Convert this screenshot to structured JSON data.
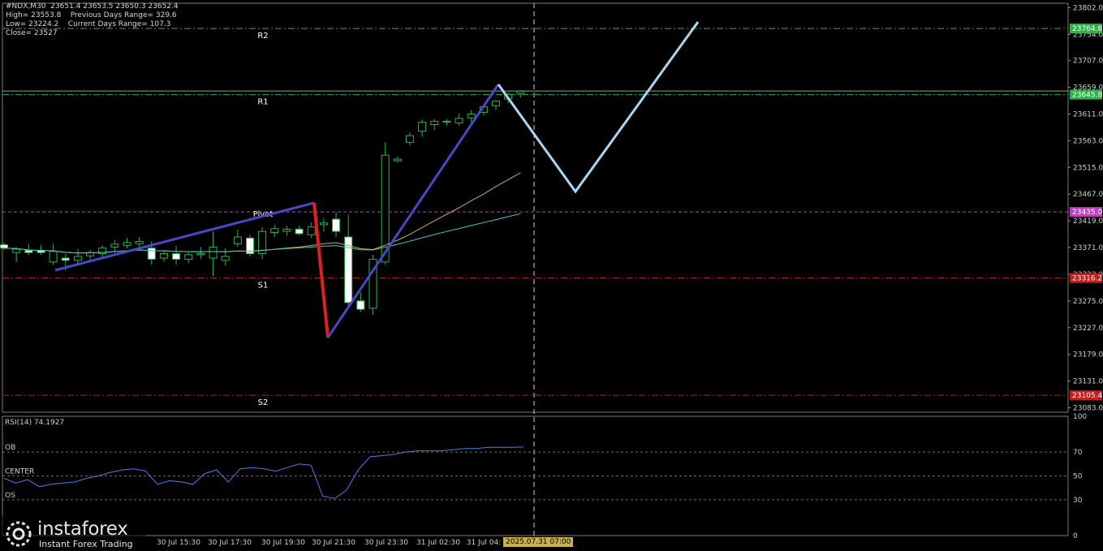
{
  "chart_data": {
    "type": "candlestick",
    "symbol_line": "#NDX,M30  23651.4 23653.5 23650.3 23652.4",
    "info_lines": [
      "High= 23553.8    Previous Days Range= 329.6",
      "Low= 23224.2    Current Days Range= 107.3",
      "Close= 23527"
    ],
    "price_axis": [
      "23802.0",
      "23754.0",
      "23707.0",
      "23659.0",
      "23611.0",
      "23563.0",
      "23515.0",
      "23467.0",
      "23419.0",
      "23371.0",
      "23323.0",
      "23275.0",
      "23227.0",
      "23179.0",
      "23131.0",
      "23083.0"
    ],
    "time_axis": [
      "30 Jul 15:30",
      "30 Jul 17:30",
      "30 Jul 19:30",
      "30 Jul 21:30",
      "30 Jul 23:30",
      "31 Jul 02:30",
      "31 Jul 04:"
    ],
    "time_tag": "2025.07.31 07:00",
    "ylim": [
      23075,
      23810
    ],
    "levels": [
      {
        "name": "R2",
        "price": 23764.6,
        "label": "23764.6",
        "color": "#2db34a",
        "style": "dashdot"
      },
      {
        "name": "R1",
        "price": 23645.8,
        "label": "23645.8",
        "color": "#2db34a",
        "style": "dashdot"
      },
      {
        "name": "Pivot",
        "price": 23435.0,
        "label": "23435.0",
        "color": "#c040c0",
        "style": "dash"
      },
      {
        "name": "S1",
        "price": 23316.2,
        "label": "23316.2",
        "color": "#c02020",
        "style": "dashdot"
      },
      {
        "name": "S2",
        "price": 23105.4,
        "label": "23105.4",
        "color": "#c02020",
        "style": "dashdot"
      }
    ],
    "level_marker_label": "23652.4",
    "candles": [
      [
        23376,
        23380,
        23366,
        23370
      ],
      [
        23362,
        23372,
        23345,
        23368
      ],
      [
        23366,
        23378,
        23357,
        23362
      ],
      [
        23366,
        23376,
        23358,
        23362
      ],
      [
        23345,
        23378,
        23340,
        23364
      ],
      [
        23352,
        23360,
        23330,
        23348
      ],
      [
        23348,
        23368,
        23340,
        23355
      ],
      [
        23356,
        23367,
        23345,
        23362
      ],
      [
        23360,
        23375,
        23352,
        23370
      ],
      [
        23372,
        23385,
        23362,
        23377
      ],
      [
        23375,
        23388,
        23370,
        23380
      ],
      [
        23378,
        23390,
        23370,
        23382
      ],
      [
        23370,
        23382,
        23340,
        23350
      ],
      [
        23352,
        23365,
        23345,
        23360
      ],
      [
        23360,
        23374,
        23340,
        23350
      ],
      [
        23350,
        23362,
        23343,
        23358
      ],
      [
        23358,
        23372,
        23350,
        23360
      ],
      [
        23352,
        23400,
        23320,
        23372
      ],
      [
        23348,
        23370,
        23338,
        23355
      ],
      [
        23378,
        23403,
        23372,
        23390
      ],
      [
        23388,
        23394,
        23355,
        23360
      ],
      [
        23360,
        23408,
        23350,
        23400
      ],
      [
        23398,
        23412,
        23390,
        23405
      ],
      [
        23400,
        23410,
        23392,
        23404
      ],
      [
        23404,
        23410,
        23393,
        23396
      ],
      [
        23394,
        23416,
        23388,
        23408
      ],
      [
        23412,
        23424,
        23400,
        23415
      ],
      [
        23422,
        23435,
        23390,
        23400
      ],
      [
        23390,
        23430,
        23262,
        23272
      ],
      [
        23275,
        23290,
        23255,
        23260
      ],
      [
        23262,
        23358,
        23250,
        23350
      ],
      [
        23345,
        23560,
        23340,
        23537
      ],
      [
        23527,
        23535,
        23524,
        23530
      ],
      [
        23560,
        23578,
        23555,
        23572
      ],
      [
        23580,
        23601,
        23570,
        23596
      ],
      [
        23592,
        23602,
        23582,
        23598
      ],
      [
        23597,
        23602,
        23590,
        23598
      ],
      [
        23595,
        23612,
        23590,
        23603
      ],
      [
        23604,
        23618,
        23596,
        23611
      ],
      [
        23614,
        23628,
        23608,
        23624
      ],
      [
        23626,
        23636,
        23618,
        23634
      ],
      [
        23638,
        23650,
        23630,
        23646
      ],
      [
        23648,
        23654,
        23640,
        23652
      ]
    ],
    "ma_fast_color": "#c9b04a",
    "ma_slow_color": "#40c8c8",
    "rsi": {
      "label": "RSI(14) 74.1927",
      "ylim": [
        0,
        100
      ],
      "axis": [
        "100",
        "70",
        "50",
        "30",
        "0"
      ],
      "levels": {
        "OB": 70,
        "CENTER": 50,
        "OS": 30
      },
      "values": [
        48,
        44,
        47,
        41,
        43,
        44,
        45,
        48,
        50,
        53,
        55,
        56,
        54,
        43,
        46,
        45,
        43,
        52,
        55,
        45,
        56,
        57,
        56,
        54,
        57,
        60,
        59,
        33,
        31,
        38,
        55,
        66,
        67,
        68,
        70,
        71,
        71,
        71,
        72,
        73,
        73,
        74,
        74,
        74,
        74.19
      ]
    }
  },
  "logo": {
    "name": "instaforex",
    "tagline": "Instant Forex Trading"
  },
  "colors": {
    "bull_body": "#000000",
    "bear_body": "#ffffff",
    "wick": "#2db34a",
    "grid": "#555555",
    "trend_blue": "#4848c8",
    "trend_red": "#dd2020",
    "projection": "#a8d8f0"
  }
}
